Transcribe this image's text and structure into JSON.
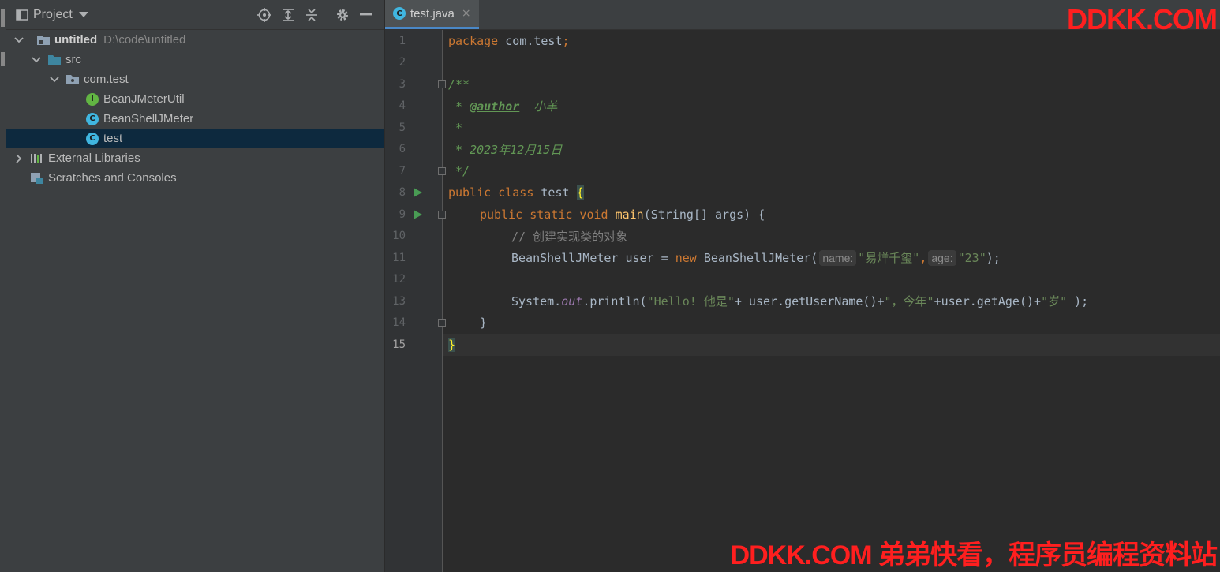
{
  "project_panel": {
    "title": "Project",
    "tree": [
      {
        "label": "untitled",
        "path": "D:\\code\\untitled"
      },
      {
        "label": "src"
      },
      {
        "label": "com.test"
      },
      {
        "label": "BeanJMeterUtil",
        "icon_letter": "I"
      },
      {
        "label": "BeanShellJMeter",
        "icon_letter": "C"
      },
      {
        "label": "test",
        "icon_letter": "C"
      },
      {
        "label": "External Libraries"
      },
      {
        "label": "Scratches and Consoles"
      }
    ]
  },
  "editor": {
    "tab_label": "test.java",
    "tab_close": "×",
    "line_numbers": [
      "1",
      "2",
      "3",
      "4",
      "5",
      "6",
      "7",
      "8",
      "9",
      "10",
      "11",
      "12",
      "13",
      "14",
      "15"
    ],
    "code": {
      "l1_kw": "package",
      "l1_rest": " com.test",
      "l1_semi": ";",
      "l3": "/**",
      "l4_star": " * ",
      "l4_tag": "@author",
      "l4_text": "  小羊",
      "l5": " *",
      "l6": " * 2023年12月15日",
      "l7": " */",
      "l8_kw": "public class",
      "l8_name": " test ",
      "l8_brace": "{",
      "l9_kw": "public static void",
      "l9_fn": "main",
      "l9_rest": "(String[] args) {",
      "l10": "// 创建实现类的对象",
      "l11_a": "BeanShellJMeter user = ",
      "l11_kw": "new",
      "l11_b": " BeanShellJMeter(",
      "l11_hint1": "name:",
      "l11_str1": "\"易烊千玺\"",
      "l11_comma": ",",
      "l11_hint2": "age:",
      "l11_str2": "\"23\"",
      "l11_end": ");",
      "l13_a": "System.",
      "l13_fld": "out",
      "l13_b": ".println(",
      "l13_str1": "\"Hello! 他是\"",
      "l13_c": "+ user.getUserName()+",
      "l13_str2": "\"，今年\"",
      "l13_d": "+user.getAge()+",
      "l13_str3": "\"岁\" ",
      "l13_end": ");",
      "l14": "}",
      "l15": "}"
    }
  },
  "watermarks": {
    "top": "DDKK.COM",
    "bottom": "DDKK.COM 弟弟快看，程序员编程资料站"
  },
  "colors": {
    "accent": "#4a88c7",
    "selection": "#0d293e",
    "watermark": "#ff1f1f"
  }
}
